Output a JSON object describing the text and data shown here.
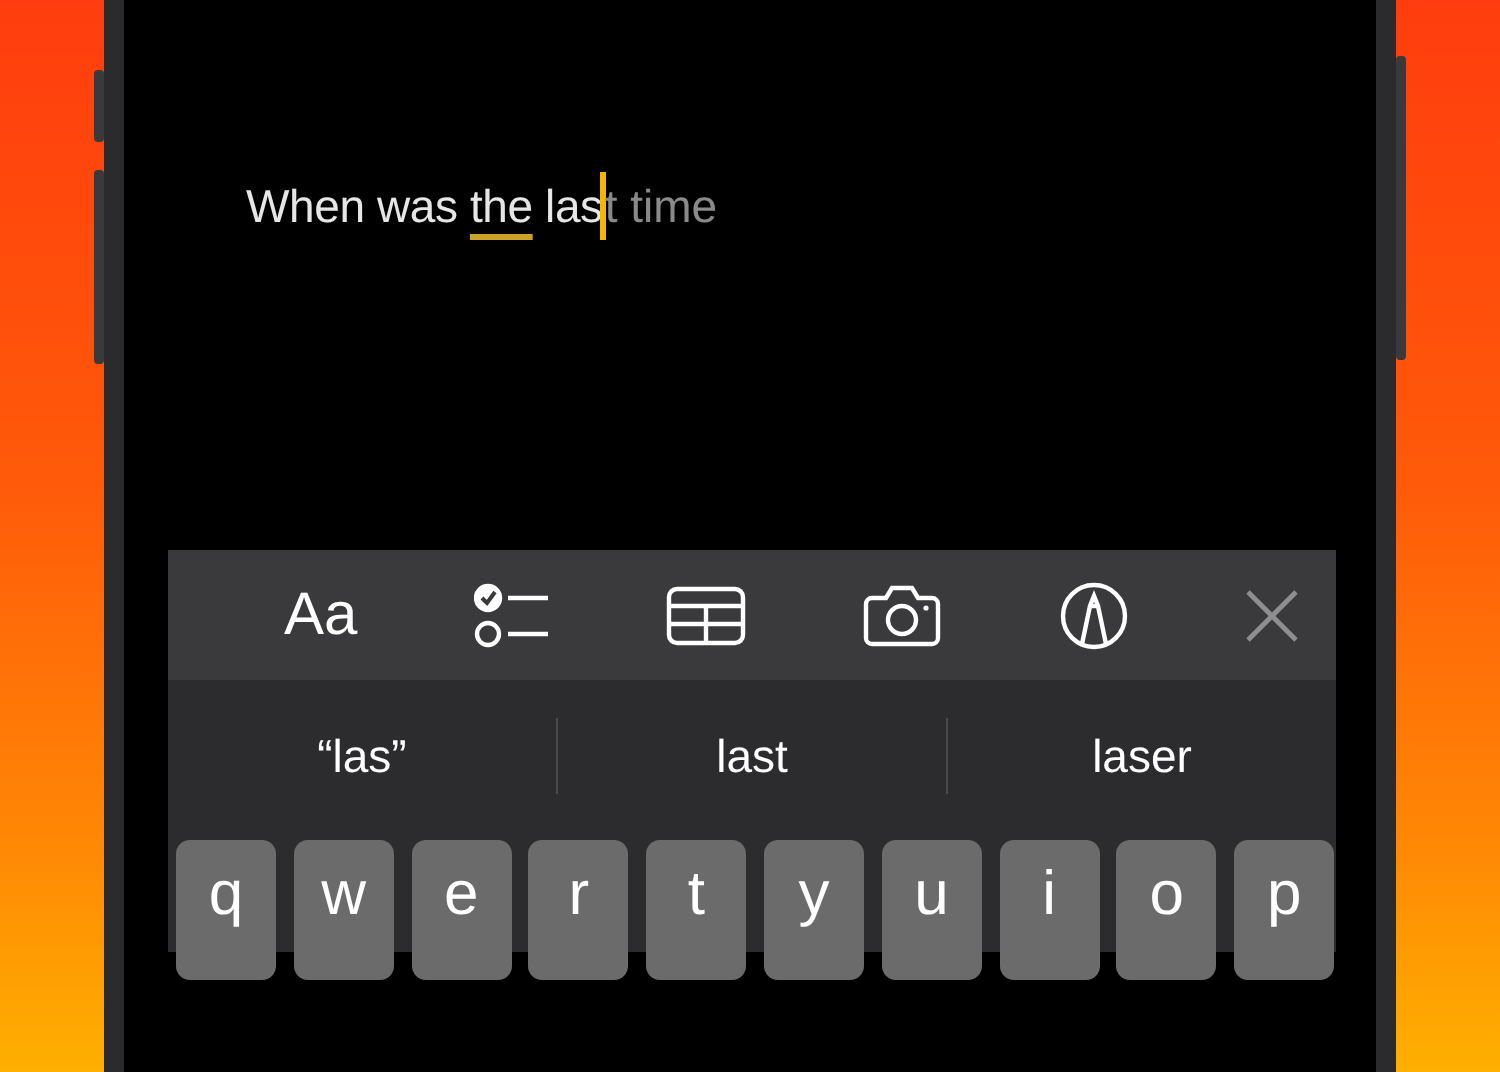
{
  "note": {
    "segments": [
      {
        "text": "When was ",
        "kind": "plain"
      },
      {
        "text": "the",
        "kind": "underlined"
      },
      {
        "text": " las",
        "kind": "plain"
      }
    ],
    "prediction": "t time"
  },
  "toolbar": {
    "format_label": "Aa",
    "tools": [
      {
        "kind": "checklist"
      },
      {
        "kind": "table"
      },
      {
        "kind": "camera"
      },
      {
        "kind": "markup"
      },
      {
        "kind": "close"
      }
    ]
  },
  "suggestions": [
    {
      "text": "“las”"
    },
    {
      "text": "last"
    },
    {
      "text": "laser"
    }
  ],
  "keys": [
    "q",
    "w",
    "e",
    "r",
    "t",
    "y",
    "u",
    "i",
    "o",
    "p"
  ]
}
